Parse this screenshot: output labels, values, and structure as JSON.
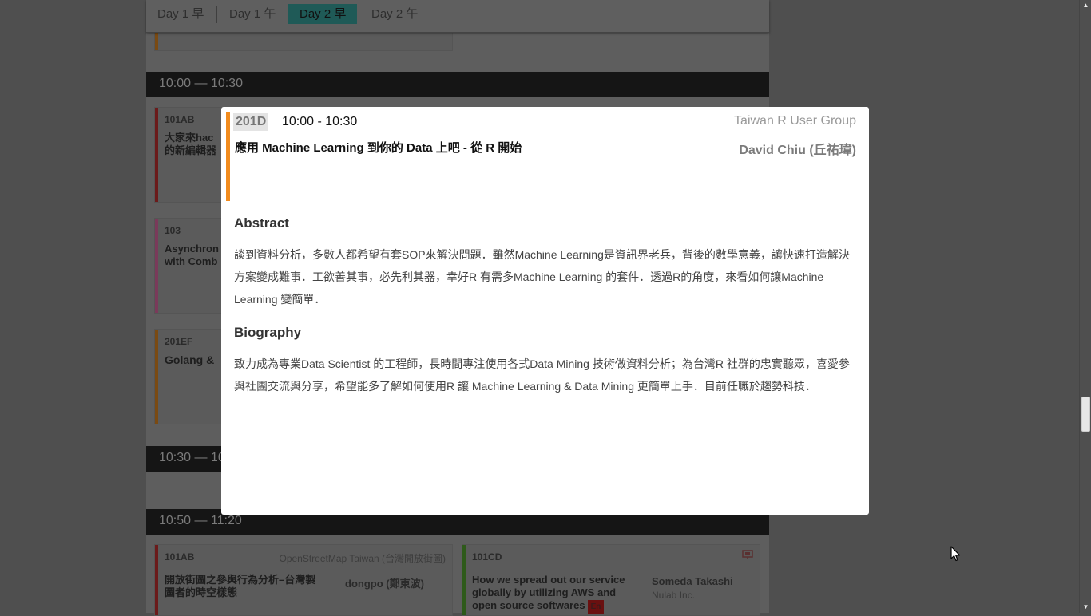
{
  "day_tabs": [
    {
      "label": "Day 1 早",
      "active": false
    },
    {
      "label": "Day 1 午",
      "active": false
    },
    {
      "label": "Day 2 早",
      "active": true
    },
    {
      "label": "Day 2 午",
      "active": false
    }
  ],
  "time_bars": [
    "10:00 — 10:30",
    "10:30 — 10",
    "10:50 — 11:20"
  ],
  "bg_sessions": [
    {
      "room": "101AB",
      "title": "大家來hac\n的新編輯器",
      "color": "#6b1a1a"
    },
    {
      "room": "103",
      "title": "Asynchron\nwith Comb",
      "color": "#7a3a5a"
    },
    {
      "room": "201EF",
      "title": "Golang &",
      "color": "#7a4a12"
    }
  ],
  "bottom_sessions": [
    {
      "room": "101AB",
      "org": "OpenStreetMap Taiwan (台灣開放街圖)",
      "title": "開放街圖之參與行為分析–台灣製\n圖者的時空樣態",
      "speaker": "dongpo (鄭東波)"
    },
    {
      "room": "101CD",
      "title": "How we spread out our service\nglobally by utilizing AWS and\nopen source softwares",
      "badge": "En",
      "speaker": "Someda Takashi",
      "company": "Nulab Inc."
    }
  ],
  "modal": {
    "room": "201D",
    "time": "10:00 - 10:30",
    "org": "Taiwan R User Group",
    "title": "應用 Machine Learning 到你的 Data 上吧 - 從 R 開始",
    "speaker": "David Chiu (丘祐瑋)",
    "accent_color": "#f28c1e",
    "abstract_heading": "Abstract",
    "abstract": "談到資料分析，多數人都希望有套SOP來解決問題．雖然Machine Learning是資訊界老兵，背後的數學意義，讓快速打造解決方案變成難事．工欲善其事，必先利其器，幸好R 有需多Machine Learning 的套件．透過R的角度，來看如何讓Machine Learning 變簡單．",
    "bio_heading": "Biography",
    "biography": "致力成為專業Data Scientist 的工程師，長時間專注使用各式Data Mining 技術做資料分析；為台灣R 社群的忠實聽眾，喜愛參與社團交流與分享，希望能多了解如何使用R 讓 Machine Learning & Data Mining 更簡單上手．目前任職於趨勢科技．"
  },
  "icons": {
    "scroll_up": "scroll-up-arrow",
    "scroll_down": "scroll-down-arrow",
    "cursor": "mouse-pointer"
  }
}
